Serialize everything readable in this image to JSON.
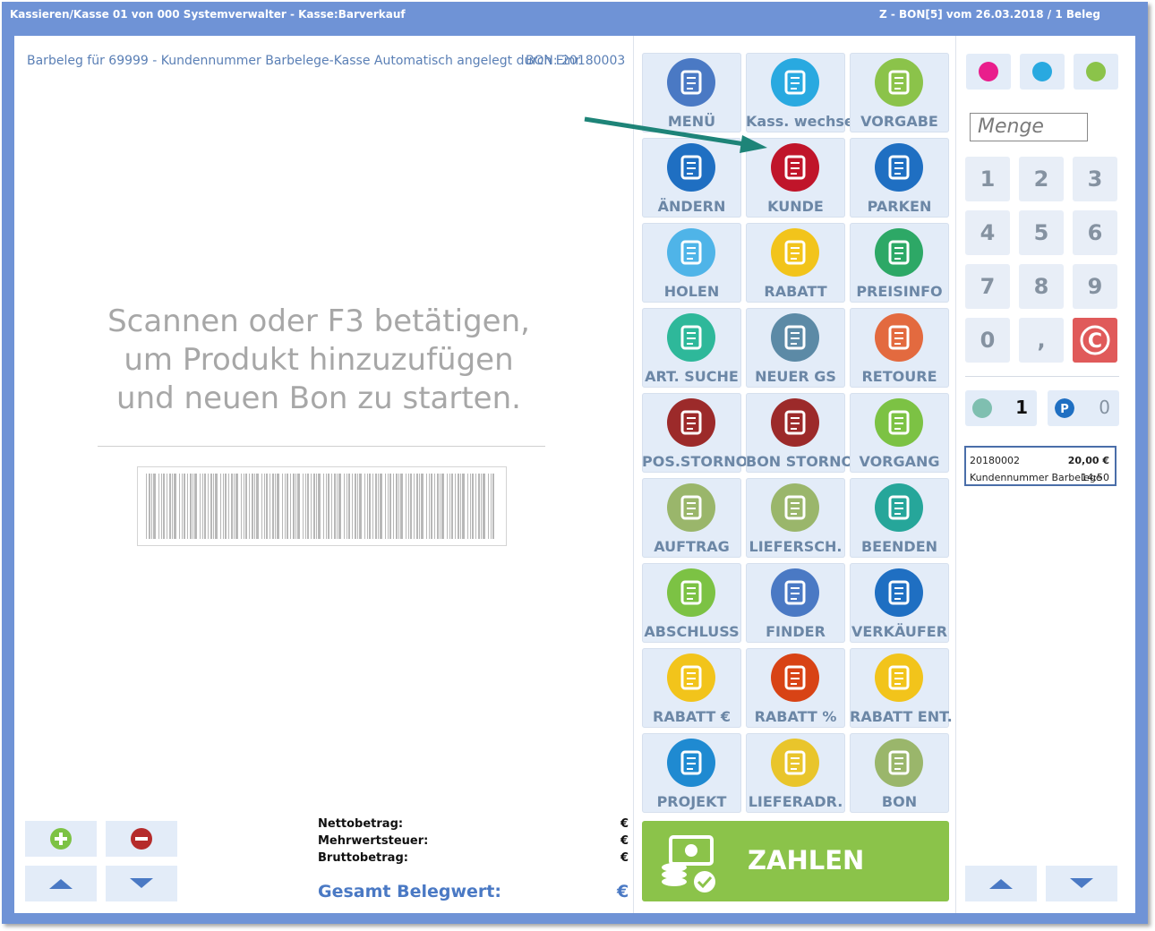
{
  "window": {
    "title_left": "Kassieren/Kasse 01 von 000 Systemverwalter - Kasse:Barverkauf",
    "title_right": "Z - BON[5] vom 26.03.2018 / 1 Beleg"
  },
  "receipt": {
    "customer_info": "Barbeleg für 69999 - Kundennummer Barbelege-Kasse Automatisch angelegt durch Einr",
    "bon_label": "BON: 20180003",
    "scan_hint_lines": [
      "Scannen oder F3 betätigen,",
      "um Produkt hinzuzufügen",
      "und neuen Bon zu starten."
    ]
  },
  "totals": {
    "netto_label": "Nettobetrag:",
    "mwst_label": "Mehrwertsteuer:",
    "brutto_label": "Bruttobetrag:",
    "gesamt_label": "Gesamt Belegwert:",
    "currency": "€"
  },
  "functions": [
    {
      "label": "MENÜ",
      "icon": "menu-icon",
      "color": "#4a79c4"
    },
    {
      "label": "Kass. wechsel",
      "icon": "user-switch-icon",
      "color": "#29a9e0"
    },
    {
      "label": "VORGABE",
      "icon": "default-settings-icon",
      "color": "#8bc34a"
    },
    {
      "label": "ÄNDERN",
      "icon": "pencil-icon",
      "color": "#1f6fc2"
    },
    {
      "label": "KUNDE",
      "icon": "customer-icon",
      "color": "#c0152a"
    },
    {
      "label": "PARKEN",
      "icon": "parking-icon",
      "color": "#1f6fc2"
    },
    {
      "label": "HOLEN",
      "icon": "fetch-receipt-icon",
      "color": "#4fb4e8"
    },
    {
      "label": "RABATT",
      "icon": "discount-icon",
      "color": "#f2c41b"
    },
    {
      "label": "PREISINFO",
      "icon": "price-info-icon",
      "color": "#2da866"
    },
    {
      "label": "ART. SUCHE",
      "icon": "article-search-icon",
      "color": "#2eb89a"
    },
    {
      "label": "NEUER GS",
      "icon": "new-voucher-icon",
      "color": "#5c8aa6"
    },
    {
      "label": "RETOURE",
      "icon": "return-icon",
      "color": "#e36a3f"
    },
    {
      "label": "POS.STORNO",
      "icon": "trash-icon",
      "color": "#9c2a2a"
    },
    {
      "label": "BON STORNO",
      "icon": "receipt-cancel-icon",
      "color": "#9c2a2a"
    },
    {
      "label": "VORGANG",
      "icon": "document-icon",
      "color": "#7cc244"
    },
    {
      "label": "AUFTRAG",
      "icon": "order-document-icon",
      "color": "#9ab66b"
    },
    {
      "label": "LIEFERSCH.",
      "icon": "delivery-note-icon",
      "color": "#9ab66b"
    },
    {
      "label": "BEENDEN",
      "icon": "power-icon",
      "color": "#26a69a"
    },
    {
      "label": "ABSCHLUSS",
      "icon": "cash-register-icon",
      "color": "#7cc244"
    },
    {
      "label": "FINDER",
      "icon": "finder-icon",
      "color": "#4a79c4"
    },
    {
      "label": "VERKÄUFER",
      "icon": "seller-icon",
      "color": "#1f6fc2"
    },
    {
      "label": "RABATT €",
      "icon": "discount-euro-icon",
      "color": "#f2c41b"
    },
    {
      "label": "RABATT %",
      "icon": "discount-percent-icon",
      "color": "#d84315"
    },
    {
      "label": "RABATT ENT.",
      "icon": "discount-remove-icon",
      "color": "#f2c41b"
    },
    {
      "label": "PROJEKT",
      "icon": "project-icon",
      "color": "#1f8ad1"
    },
    {
      "label": "LIEFERADR.",
      "icon": "delivery-truck-icon",
      "color": "#e9c52b"
    },
    {
      "label": "BON",
      "icon": "bon-icon",
      "color": "#9ab66b"
    }
  ],
  "pay_button": {
    "label": "ZAHLEN",
    "icon": "cash-money-icon",
    "color": "#8bc34a"
  },
  "quick_buttons": [
    {
      "icon": "bag-pink-icon",
      "color": "#e91e8c"
    },
    {
      "icon": "bag-cyan-icon",
      "color": "#29a9e0"
    },
    {
      "icon": "cash-green-icon",
      "color": "#8bc34a"
    }
  ],
  "keypad": {
    "placeholder": "Menge",
    "keys": [
      "1",
      "2",
      "3",
      "4",
      "5",
      "6",
      "7",
      "8",
      "9",
      "0",
      ",",
      "C"
    ]
  },
  "counters": {
    "open_receipts": "1",
    "parked": "0"
  },
  "parked_bon": {
    "id": "20180002",
    "amount": "20,00 €",
    "desc": "Kundennummer Barbelege",
    "time": "14:50"
  }
}
